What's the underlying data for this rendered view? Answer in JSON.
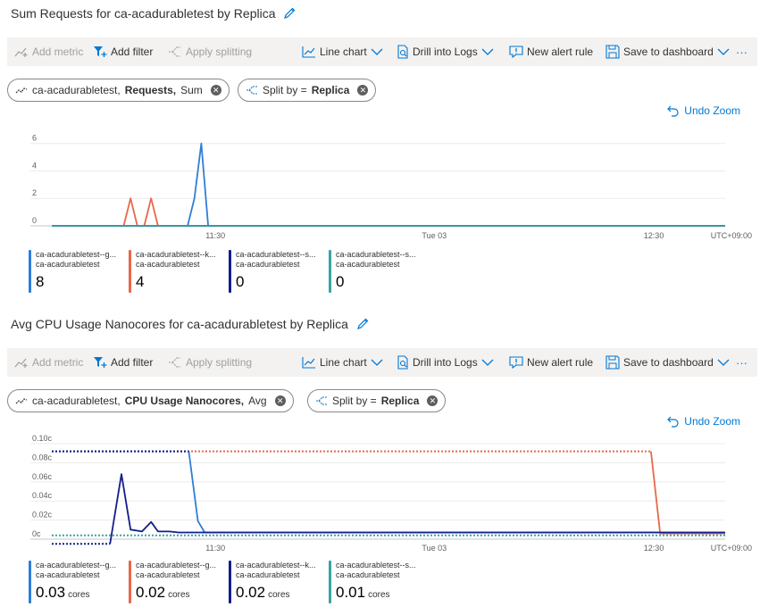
{
  "toolbar": {
    "add_metric": "Add metric",
    "add_filter": "Add filter",
    "apply_splitting": "Apply splitting",
    "line_chart": "Line chart",
    "drill_logs": "Drill into Logs",
    "new_alert": "New alert rule",
    "save_dashboard": "Save to dashboard",
    "more": "···"
  },
  "undo_zoom": "Undo Zoom",
  "colors": {
    "blue": "#2f7ed8",
    "orange": "#e8684a",
    "navy": "#141d8c",
    "teal": "#39a4a5",
    "link": "#0078d4"
  },
  "panels": [
    {
      "title": "Sum Requests for ca-acadurabletest by Replica",
      "metric_pill": {
        "resource": "ca-acadurabletest,",
        "metric": "Requests,",
        "agg": "Sum"
      },
      "split_pill": {
        "label": "Split by =",
        "value": "Replica"
      },
      "legend": [
        {
          "name": "ca-acadurabletest--g...",
          "resource": "ca-acadurabletest",
          "value": "8",
          "unit": ""
        },
        {
          "name": "ca-acadurabletest--k...",
          "resource": "ca-acadurabletest",
          "value": "4",
          "unit": ""
        },
        {
          "name": "ca-acadurabletest--s...",
          "resource": "ca-acadurabletest",
          "value": "0",
          "unit": ""
        },
        {
          "name": "ca-acadurabletest--s...",
          "resource": "ca-acadurabletest",
          "value": "0",
          "unit": ""
        }
      ]
    },
    {
      "title": "Avg CPU Usage Nanocores for ca-acadurabletest by Replica",
      "metric_pill": {
        "resource": "ca-acadurabletest,",
        "metric": "CPU Usage Nanocores,",
        "agg": "Avg"
      },
      "split_pill": {
        "label": "Split by =",
        "value": "Replica"
      },
      "legend": [
        {
          "name": "ca-acadurabletest--g...",
          "resource": "ca-acadurabletest",
          "value": "0.03",
          "unit": "cores"
        },
        {
          "name": "ca-acadurabletest--g...",
          "resource": "ca-acadurabletest",
          "value": "0.02",
          "unit": "cores"
        },
        {
          "name": "ca-acadurabletest--k...",
          "resource": "ca-acadurabletest",
          "value": "0.02",
          "unit": "cores"
        },
        {
          "name": "ca-acadurabletest--s...",
          "resource": "ca-acadurabletest",
          "value": "0.01",
          "unit": "cores"
        }
      ]
    }
  ],
  "chart_data": [
    {
      "type": "line",
      "x_ticks": [
        "11:30",
        "Tue 03",
        "12:30"
      ],
      "x_tick_pos": [
        0.243,
        0.568,
        0.894
      ],
      "timezone": "UTC+09:00",
      "y_ticks": [
        "0",
        "2",
        "4",
        "6"
      ],
      "ylim": [
        0,
        6.5
      ],
      "grid": true,
      "x_count": 60,
      "series": [
        {
          "color": "#2f7ed8",
          "style": "solid",
          "points": [
            [
              0,
              0
            ],
            [
              11.9,
              0
            ],
            [
              12.5,
              2
            ],
            [
              13.1,
              6
            ],
            [
              13.7,
              0
            ],
            [
              59,
              0
            ]
          ]
        },
        {
          "color": "#e8684a",
          "style": "solid",
          "points": [
            [
              0,
              0
            ],
            [
              6.3,
              0
            ],
            [
              6.9,
              2
            ],
            [
              7.5,
              0
            ],
            [
              8.1,
              0
            ],
            [
              8.7,
              2
            ],
            [
              9.3,
              0
            ],
            [
              59,
              0
            ]
          ]
        },
        {
          "color": "#141d8c",
          "style": "solid",
          "points": [
            [
              0,
              0
            ],
            [
              59,
              0
            ]
          ]
        },
        {
          "color": "#39a4a5",
          "style": "solid",
          "points": [
            [
              0,
              0
            ],
            [
              59,
              0
            ]
          ]
        }
      ]
    },
    {
      "type": "line",
      "x_ticks": [
        "11:30",
        "Tue 03",
        "12:30"
      ],
      "x_tick_pos": [
        0.243,
        0.568,
        0.894
      ],
      "timezone": "UTC+09:00",
      "y_ticks": [
        "0c",
        "0.02c",
        "0.04c",
        "0.06c",
        "0.08c",
        "0.10c"
      ],
      "ylim": [
        0,
        0.1
      ],
      "grid": true,
      "x_count": 60,
      "series": [
        {
          "color": "#e8684a",
          "style": "dashed",
          "points": [
            [
              0,
              0.092
            ],
            [
              52.5,
              0.092
            ]
          ]
        },
        {
          "color": "#e8684a",
          "style": "solid",
          "points": [
            [
              52.5,
              0.092
            ],
            [
              53.3,
              0.006
            ],
            [
              59,
              0.006
            ]
          ]
        },
        {
          "color": "#2f7ed8",
          "style": "dashed",
          "points": [
            [
              0,
              0.092
            ],
            [
              12,
              0.092
            ]
          ]
        },
        {
          "color": "#2f7ed8",
          "style": "solid",
          "points": [
            [
              12,
              0.092
            ],
            [
              12.8,
              0.019
            ],
            [
              13.4,
              0.007
            ],
            [
              59,
              0.007
            ]
          ]
        },
        {
          "color": "#141d8c",
          "style": "dashed",
          "points": [
            [
              0,
              0.092
            ],
            [
              12,
              0.092
            ]
          ]
        },
        {
          "color": "#141d8c",
          "style": "dashed",
          "points": [
            [
              0,
              -0.005
            ],
            [
              5.1,
              -0.005
            ]
          ]
        },
        {
          "color": "#141d8c",
          "style": "solid",
          "points": [
            [
              5.1,
              -0.005
            ],
            [
              6.1,
              0.068
            ],
            [
              6.9,
              0.01
            ],
            [
              7.9,
              0.008
            ],
            [
              8.7,
              0.018
            ],
            [
              9.3,
              0.008
            ],
            [
              10.3,
              0.008
            ],
            [
              11.1,
              0.007
            ],
            [
              59,
              0.007
            ]
          ]
        },
        {
          "color": "#39a4a5",
          "style": "dashed",
          "points": [
            [
              0,
              0.004
            ],
            [
              59,
              0.004
            ]
          ]
        }
      ]
    }
  ]
}
